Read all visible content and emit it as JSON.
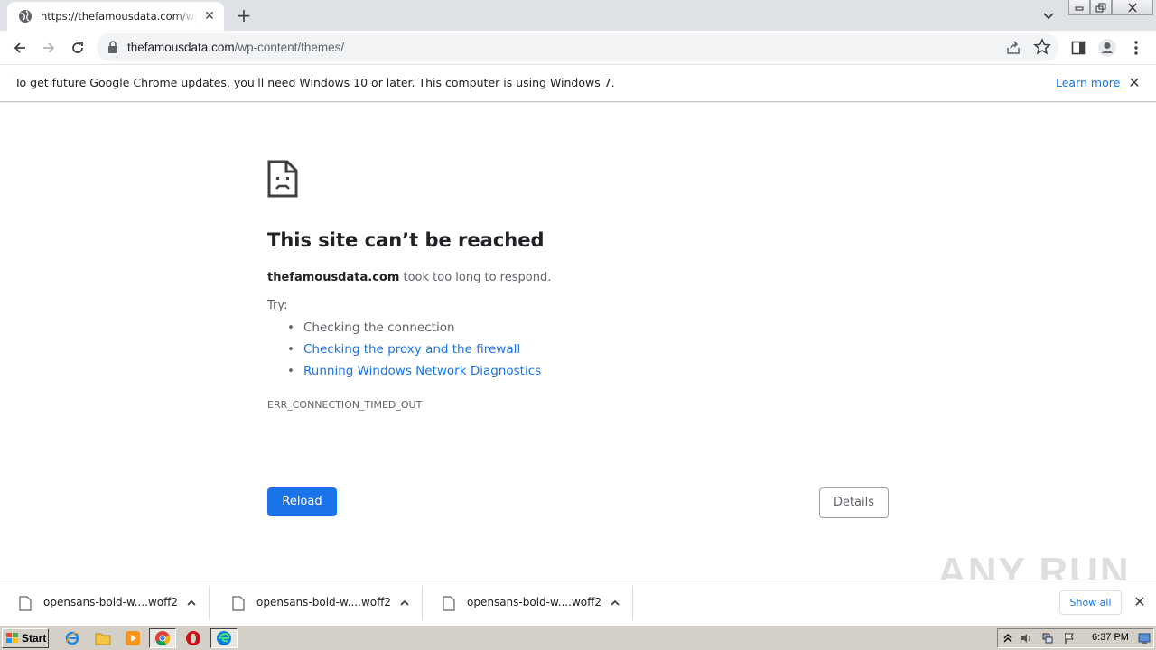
{
  "browser": {
    "tab": {
      "title": "https://thefamousdata.com/wp-content/themes/"
    },
    "address": {
      "domain": "thefamousdata.com",
      "path": "/wp-content/themes/"
    }
  },
  "infobar": {
    "message": "To get future Google Chrome updates, you'll need Windows 10 or later. This computer is using Windows 7.",
    "learn_more": "Learn more"
  },
  "error_page": {
    "title": "This site can’t be reached",
    "host": "thefamousdata.com",
    "description_suffix": " took too long to respond.",
    "try_label": "Try:",
    "suggestions": [
      {
        "text": "Checking the connection"
      },
      {
        "text": "Checking the proxy and the firewall"
      },
      {
        "text": "Running Windows Network Diagnostics"
      }
    ],
    "error_code": "ERR_CONNECTION_TIMED_OUT",
    "reload_label": "Reload",
    "details_label": "Details"
  },
  "watermark": "ANY RUN",
  "downloads": {
    "items": [
      {
        "name": "opensans-bold-w....woff2"
      },
      {
        "name": "opensans-bold-w....woff2"
      },
      {
        "name": "opensans-bold-w....woff2"
      }
    ],
    "show_all": "Show all"
  },
  "taskbar": {
    "start_label": "Start",
    "clock": "6:37 PM"
  },
  "colors": {
    "accent": "#1a73e8",
    "tabstrip": "#dee1e6",
    "taskbar": "#d4d0c8"
  }
}
